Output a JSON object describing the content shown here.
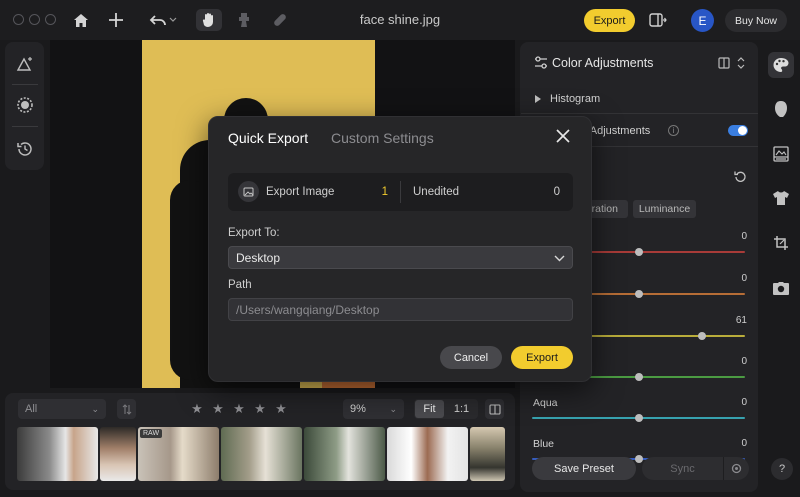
{
  "titlebar": {
    "title": "face shine.jpg",
    "export_label": "Export",
    "avatar_initial": "E",
    "buy_label": "Buy Now"
  },
  "right_panel": {
    "title": "Color Adjustments",
    "histogram_label": "Histogram",
    "color_adjustments_label": "Color Adjustments",
    "color_adjustments_enabled": true,
    "tabs": [
      "Saturation",
      "Luminance"
    ],
    "sliders": [
      {
        "label": "",
        "value": "0",
        "level": 0.5,
        "color": "#c0403c"
      },
      {
        "label": "",
        "value": "0",
        "level": 0.5,
        "color": "#d07a3a"
      },
      {
        "label": "",
        "value": "61",
        "level": 0.8,
        "color": "#d4c640"
      },
      {
        "label": "",
        "value": "0",
        "level": 0.5,
        "color": "#52b048"
      },
      {
        "label": "Aqua",
        "value": "0",
        "level": 0.5,
        "color": "#3bb8c8"
      },
      {
        "label": "Blue",
        "value": "0",
        "level": 0.5,
        "color": "#3a66d8"
      }
    ],
    "save_preset_label": "Save Preset",
    "sync_label": "Sync"
  },
  "right_icons": [
    "palette-icon",
    "face-icon",
    "image-adjust-icon",
    "clothing-icon",
    "crop-icon",
    "camera-icon"
  ],
  "help_label": "?",
  "filmstrip": {
    "filter_value": "All",
    "zoom_value": "9%",
    "fit_label": "Fit",
    "one_to_one_label": "1:1",
    "stars": 5,
    "raw_badge": "RAW"
  },
  "dialog": {
    "tab_quick": "Quick Export",
    "tab_custom": "Custom Settings",
    "export_image_label": "Export Image",
    "export_image_count": "1",
    "unedited_label": "Unedited",
    "unedited_count": "0",
    "export_to_label": "Export To:",
    "export_to_value": "Desktop",
    "path_label": "Path",
    "path_value": "/Users/wangqiang/Desktop",
    "cancel_label": "Cancel",
    "export_label": "Export"
  },
  "colors": {
    "accent": "#f2cc2e",
    "toggle_blue": "#3a7ee0",
    "avatar_blue": "#2856c6"
  }
}
